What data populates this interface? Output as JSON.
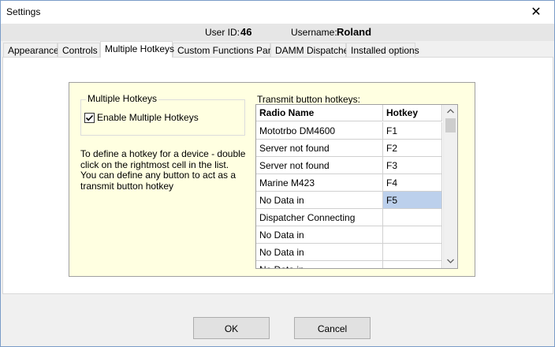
{
  "window": {
    "title": "Settings",
    "close_glyph": "✕"
  },
  "user_bar": {
    "user_id_label": "User ID:",
    "user_id_value": "46",
    "username_label": "Username:",
    "username_value": "Roland"
  },
  "tabs": [
    {
      "label": "Appearance",
      "active": false
    },
    {
      "label": "Controls",
      "active": false
    },
    {
      "label": "Multiple Hotkeys",
      "active": true
    },
    {
      "label": "Custom Functions Panel",
      "active": false
    },
    {
      "label": "DAMM Dispatcher",
      "active": false
    },
    {
      "label": "Installed options",
      "active": false
    }
  ],
  "hotkeys_panel": {
    "group_title": "Multiple Hotkeys",
    "checkbox_label": "Enable Multiple Hotkeys",
    "checkbox_checked": true,
    "description": "To define a hotkey for a device - double click on the rightmost cell in the list. You can define any button to act as a transmit button hotkey",
    "grid_label": "Transmit button hotkeys:",
    "columns": [
      "Radio Name",
      "Hotkey"
    ],
    "rows": [
      {
        "radio": "Mototrbo DM4600",
        "hotkey": "F1",
        "selected": false
      },
      {
        "radio": "Server not found",
        "hotkey": "F2",
        "selected": false
      },
      {
        "radio": "Server not found",
        "hotkey": "F3",
        "selected": false
      },
      {
        "radio": "Marine M423",
        "hotkey": "F4",
        "selected": false
      },
      {
        "radio": "No Data in",
        "hotkey": "F5",
        "selected": true
      },
      {
        "radio": "Dispatcher Connecting",
        "hotkey": "",
        "selected": false
      },
      {
        "radio": "No Data in",
        "hotkey": "",
        "selected": false
      },
      {
        "radio": "No Data in",
        "hotkey": "",
        "selected": false
      },
      {
        "radio": "No Data in",
        "hotkey": "",
        "selected": false
      }
    ],
    "selection_color": "#bcd0ec"
  },
  "buttons": {
    "ok": "OK",
    "cancel": "Cancel"
  },
  "icons": {
    "close": "close-icon",
    "check": "check-icon",
    "scroll_up": "chevron-up-icon",
    "scroll_down": "chevron-down-icon"
  }
}
